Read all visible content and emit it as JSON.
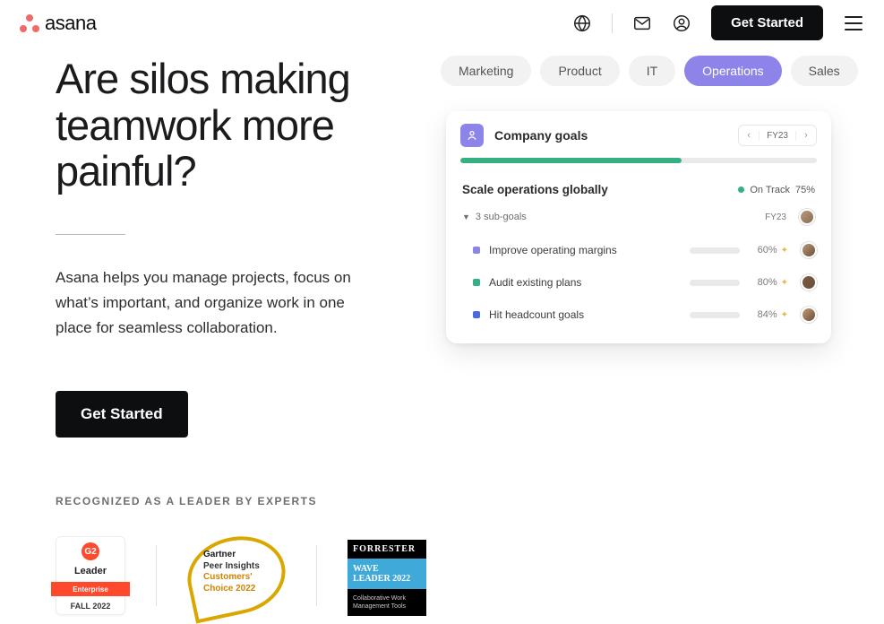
{
  "nav": {
    "logo_text": "asana",
    "cta": "Get Started"
  },
  "hero": {
    "title": "Are silos making teamwork more painful?",
    "subtitle": "Asana helps you manage projects, focus on what’s important, and organize work in one place for seamless collaboration.",
    "cta": "Get Started"
  },
  "recognized": {
    "label": "RECOGNIZED AS A LEADER BY EXPERTS",
    "g2": {
      "title": "Leader",
      "ribbon": "Enterprise",
      "period": "FALL 2022",
      "mark": "G2"
    },
    "gartner": {
      "brand": "Gartner",
      "line1": "Peer Insights",
      "line2": "Customers'",
      "line3": "Choice 2022"
    },
    "forrester": {
      "brand": "FORRESTER",
      "mid1": "WAVE",
      "mid2": "LEADER 2022",
      "foot": "Collaborative Work Management Tools"
    }
  },
  "tabs": [
    {
      "label": "Marketing",
      "active": false
    },
    {
      "label": "Product",
      "active": false
    },
    {
      "label": "IT",
      "active": false
    },
    {
      "label": "Operations",
      "active": true
    },
    {
      "label": "Sales",
      "active": false
    }
  ],
  "card": {
    "title": "Company goals",
    "period": "FY23",
    "main_goal": {
      "name": "Scale operations globally",
      "status": "On Track",
      "pct": "75%"
    },
    "sub_label": "3 sub-goals",
    "sub_period": "FY23",
    "goals": [
      {
        "color": "#8c84e8",
        "name": "Improve operating margins",
        "pct_num": 60,
        "pct": "60%"
      },
      {
        "color": "#35b082",
        "name": "Audit existing plans",
        "pct_num": 80,
        "pct": "80%"
      },
      {
        "color": "#4b6ae0",
        "name": "Hit headcount goals",
        "pct_num": 84,
        "pct": "84%"
      }
    ],
    "avatar_colors": [
      "#b89b7a",
      "#7a5c44",
      "#c49a78",
      "#8a6b52"
    ]
  }
}
